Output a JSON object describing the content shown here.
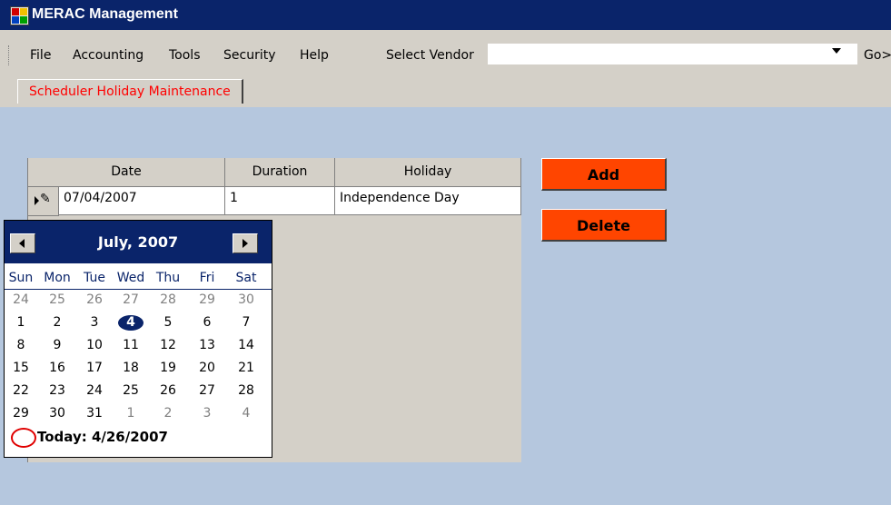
{
  "app": {
    "title": "MERAC Management"
  },
  "menu": {
    "items": [
      "File",
      "Accounting",
      "Tools",
      "Security",
      "Help"
    ],
    "vendor_label": "Select Vendor",
    "vendor_value": "",
    "go_label": "Go>"
  },
  "tab": {
    "label": "Scheduler Holiday Maintenance"
  },
  "grid": {
    "columns": [
      "Date",
      "Duration",
      "Holiday"
    ],
    "row": {
      "date": "07/04/2007",
      "duration": "1",
      "holiday": "Independence Day"
    }
  },
  "buttons": {
    "add": "Add",
    "delete": "Delete"
  },
  "calendar": {
    "title": "July, 2007",
    "days_of_week": [
      "Sun",
      "Mon",
      "Tue",
      "Wed",
      "Thu",
      "Fri",
      "Sat"
    ],
    "weeks": [
      [
        "24",
        "25",
        "26",
        "27",
        "28",
        "29",
        "30"
      ],
      [
        "1",
        "2",
        "3",
        "4",
        "5",
        "6",
        "7"
      ],
      [
        "8",
        "9",
        "10",
        "11",
        "12",
        "13",
        "14"
      ],
      [
        "15",
        "16",
        "17",
        "18",
        "19",
        "20",
        "21"
      ],
      [
        "22",
        "23",
        "24",
        "25",
        "26",
        "27",
        "28"
      ],
      [
        "29",
        "30",
        "31",
        "1",
        "2",
        "3",
        "4"
      ]
    ],
    "selected_day": "4",
    "today_label": "Today: 4/26/2007"
  },
  "colors": {
    "titlebar": "#0a246a",
    "content_background": "#b5c7de",
    "action_button": "#ff4500",
    "tab_text": "#ff0000"
  },
  "icons": {
    "app": "merac-app-icon",
    "row_edit": "row-editing-pencil-icon",
    "today_marker": "today-circle-icon"
  }
}
